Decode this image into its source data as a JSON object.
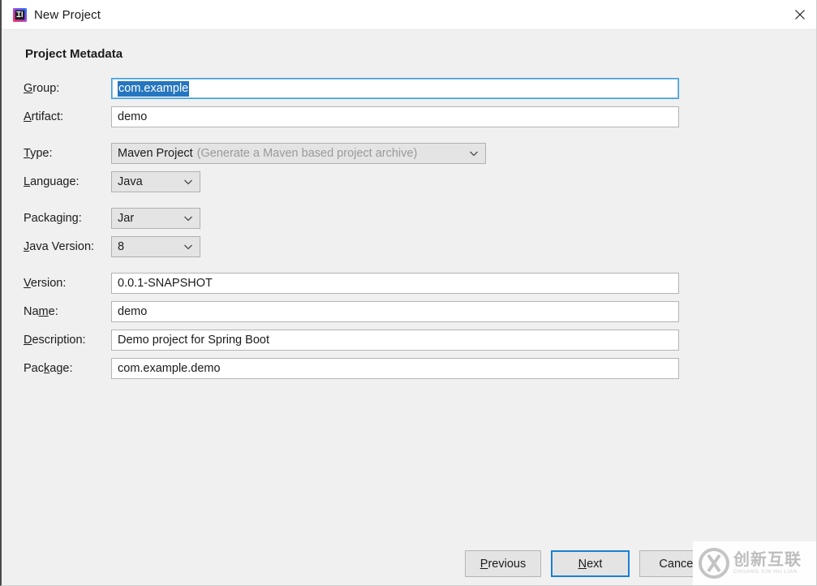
{
  "window": {
    "title": "New Project",
    "icon": "intellij-idea-icon",
    "close_icon": "close-icon"
  },
  "section": {
    "heading": "Project Metadata"
  },
  "fields": {
    "group": {
      "label_pre": "",
      "label_mn": "G",
      "label_post": "roup:",
      "value": "com.example",
      "selected": true,
      "focused": true
    },
    "artifact": {
      "label_pre": "",
      "label_mn": "A",
      "label_post": "rtifact:",
      "value": "demo"
    },
    "type": {
      "label_pre": "",
      "label_mn": "T",
      "label_post": "ype:",
      "value": "Maven Project",
      "hint": "(Generate a Maven based project archive)"
    },
    "language": {
      "label_pre": "",
      "label_mn": "L",
      "label_post": "anguage:",
      "value": "Java"
    },
    "packaging": {
      "label_pre": "Packa",
      "label_mn": "g",
      "label_post": "ing:",
      "value": "Jar"
    },
    "java_version": {
      "label_pre": "",
      "label_mn": "J",
      "label_post": "ava Version:",
      "value": "8"
    },
    "version": {
      "label_pre": "",
      "label_mn": "V",
      "label_post": "ersion:",
      "value": "0.0.1-SNAPSHOT"
    },
    "name": {
      "label_pre": "Na",
      "label_mn": "m",
      "label_post": "e:",
      "value": "demo"
    },
    "description": {
      "label_pre": "",
      "label_mn": "D",
      "label_post": "escription:",
      "value": "Demo project for Spring Boot"
    },
    "package": {
      "label_pre": "Pac",
      "label_mn": "k",
      "label_post": "age:",
      "value": "com.example.demo"
    }
  },
  "buttons": {
    "previous": {
      "pre": "",
      "mn": "P",
      "post": "revious"
    },
    "next": {
      "pre": "",
      "mn": "N",
      "post": "ext",
      "is_default": true
    },
    "cancel": {
      "pre": "Cancel",
      "mn": "",
      "post": ""
    }
  },
  "watermark": {
    "cn": "创新互联",
    "pinyin": "CHUANG XIN HU LIAN",
    "logo": "cx-circle-logo"
  },
  "colors": {
    "accent_blue": "#1a7fd4",
    "selection_blue": "#2675bf",
    "titlebar_bg": "#ffffff",
    "dialog_bg": "#f0f0f0",
    "field_bg": "#ffffff",
    "combo_bg": "#e4e4e4",
    "hint_gray": "#9a9a9a"
  }
}
